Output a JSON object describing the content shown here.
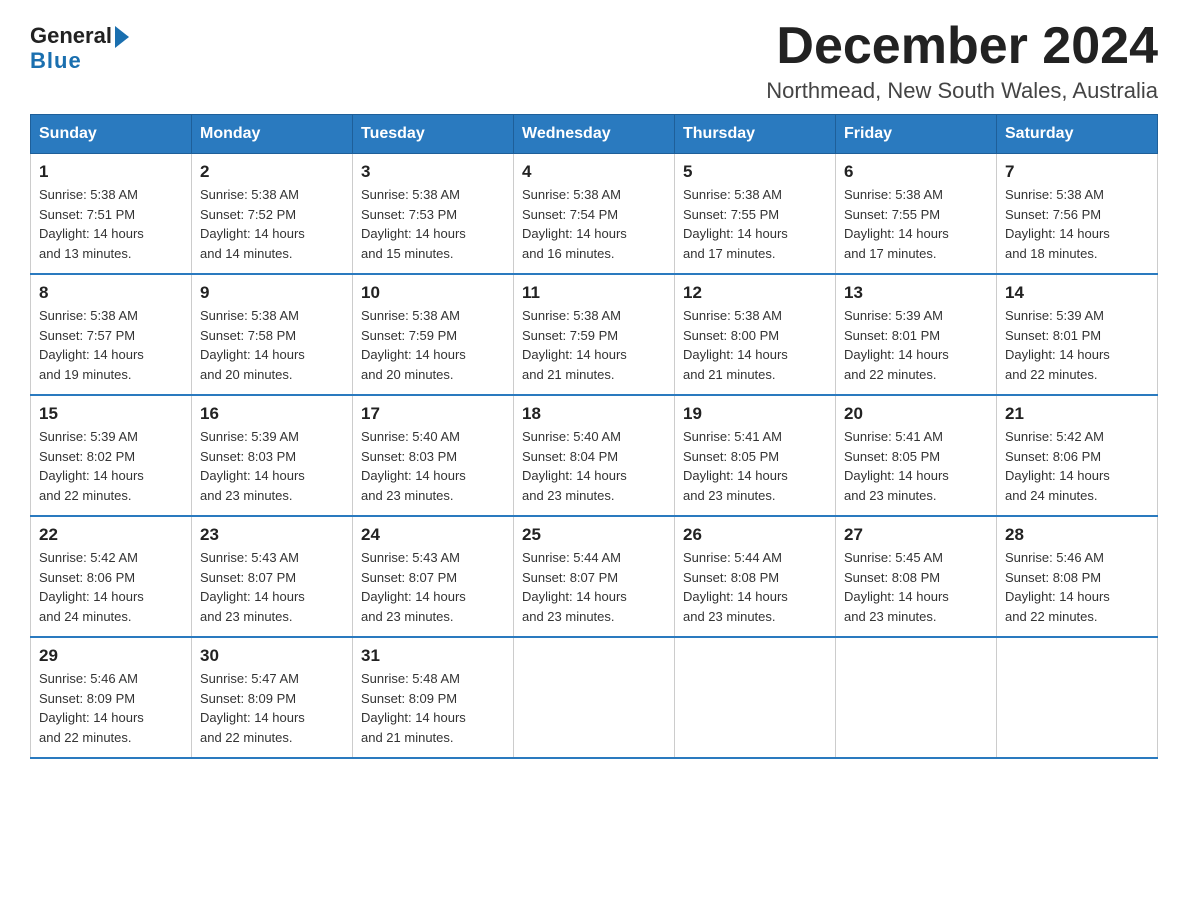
{
  "header": {
    "logo_general": "General",
    "logo_blue": "Blue",
    "month_year": "December 2024",
    "location": "Northmead, New South Wales, Australia"
  },
  "weekdays": [
    "Sunday",
    "Monday",
    "Tuesday",
    "Wednesday",
    "Thursday",
    "Friday",
    "Saturday"
  ],
  "weeks": [
    [
      {
        "day": "1",
        "sunrise": "5:38 AM",
        "sunset": "7:51 PM",
        "daylight": "14 hours and 13 minutes."
      },
      {
        "day": "2",
        "sunrise": "5:38 AM",
        "sunset": "7:52 PM",
        "daylight": "14 hours and 14 minutes."
      },
      {
        "day": "3",
        "sunrise": "5:38 AM",
        "sunset": "7:53 PM",
        "daylight": "14 hours and 15 minutes."
      },
      {
        "day": "4",
        "sunrise": "5:38 AM",
        "sunset": "7:54 PM",
        "daylight": "14 hours and 16 minutes."
      },
      {
        "day": "5",
        "sunrise": "5:38 AM",
        "sunset": "7:55 PM",
        "daylight": "14 hours and 17 minutes."
      },
      {
        "day": "6",
        "sunrise": "5:38 AM",
        "sunset": "7:55 PM",
        "daylight": "14 hours and 17 minutes."
      },
      {
        "day": "7",
        "sunrise": "5:38 AM",
        "sunset": "7:56 PM",
        "daylight": "14 hours and 18 minutes."
      }
    ],
    [
      {
        "day": "8",
        "sunrise": "5:38 AM",
        "sunset": "7:57 PM",
        "daylight": "14 hours and 19 minutes."
      },
      {
        "day": "9",
        "sunrise": "5:38 AM",
        "sunset": "7:58 PM",
        "daylight": "14 hours and 20 minutes."
      },
      {
        "day": "10",
        "sunrise": "5:38 AM",
        "sunset": "7:59 PM",
        "daylight": "14 hours and 20 minutes."
      },
      {
        "day": "11",
        "sunrise": "5:38 AM",
        "sunset": "7:59 PM",
        "daylight": "14 hours and 21 minutes."
      },
      {
        "day": "12",
        "sunrise": "5:38 AM",
        "sunset": "8:00 PM",
        "daylight": "14 hours and 21 minutes."
      },
      {
        "day": "13",
        "sunrise": "5:39 AM",
        "sunset": "8:01 PM",
        "daylight": "14 hours and 22 minutes."
      },
      {
        "day": "14",
        "sunrise": "5:39 AM",
        "sunset": "8:01 PM",
        "daylight": "14 hours and 22 minutes."
      }
    ],
    [
      {
        "day": "15",
        "sunrise": "5:39 AM",
        "sunset": "8:02 PM",
        "daylight": "14 hours and 22 minutes."
      },
      {
        "day": "16",
        "sunrise": "5:39 AM",
        "sunset": "8:03 PM",
        "daylight": "14 hours and 23 minutes."
      },
      {
        "day": "17",
        "sunrise": "5:40 AM",
        "sunset": "8:03 PM",
        "daylight": "14 hours and 23 minutes."
      },
      {
        "day": "18",
        "sunrise": "5:40 AM",
        "sunset": "8:04 PM",
        "daylight": "14 hours and 23 minutes."
      },
      {
        "day": "19",
        "sunrise": "5:41 AM",
        "sunset": "8:05 PM",
        "daylight": "14 hours and 23 minutes."
      },
      {
        "day": "20",
        "sunrise": "5:41 AM",
        "sunset": "8:05 PM",
        "daylight": "14 hours and 23 minutes."
      },
      {
        "day": "21",
        "sunrise": "5:42 AM",
        "sunset": "8:06 PM",
        "daylight": "14 hours and 24 minutes."
      }
    ],
    [
      {
        "day": "22",
        "sunrise": "5:42 AM",
        "sunset": "8:06 PM",
        "daylight": "14 hours and 24 minutes."
      },
      {
        "day": "23",
        "sunrise": "5:43 AM",
        "sunset": "8:07 PM",
        "daylight": "14 hours and 23 minutes."
      },
      {
        "day": "24",
        "sunrise": "5:43 AM",
        "sunset": "8:07 PM",
        "daylight": "14 hours and 23 minutes."
      },
      {
        "day": "25",
        "sunrise": "5:44 AM",
        "sunset": "8:07 PM",
        "daylight": "14 hours and 23 minutes."
      },
      {
        "day": "26",
        "sunrise": "5:44 AM",
        "sunset": "8:08 PM",
        "daylight": "14 hours and 23 minutes."
      },
      {
        "day": "27",
        "sunrise": "5:45 AM",
        "sunset": "8:08 PM",
        "daylight": "14 hours and 23 minutes."
      },
      {
        "day": "28",
        "sunrise": "5:46 AM",
        "sunset": "8:08 PM",
        "daylight": "14 hours and 22 minutes."
      }
    ],
    [
      {
        "day": "29",
        "sunrise": "5:46 AM",
        "sunset": "8:09 PM",
        "daylight": "14 hours and 22 minutes."
      },
      {
        "day": "30",
        "sunrise": "5:47 AM",
        "sunset": "8:09 PM",
        "daylight": "14 hours and 22 minutes."
      },
      {
        "day": "31",
        "sunrise": "5:48 AM",
        "sunset": "8:09 PM",
        "daylight": "14 hours and 21 minutes."
      },
      null,
      null,
      null,
      null
    ]
  ],
  "labels": {
    "sunrise": "Sunrise:",
    "sunset": "Sunset:",
    "daylight": "Daylight:"
  }
}
